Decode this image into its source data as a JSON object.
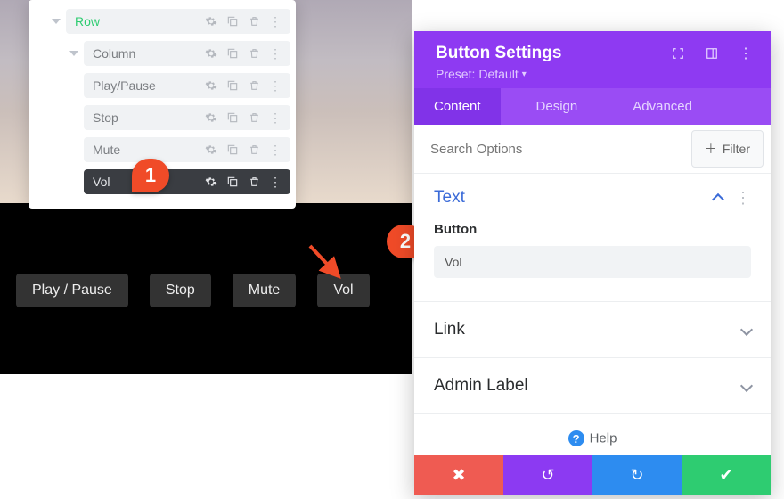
{
  "structure": {
    "row": "Row",
    "column": "Column",
    "items": [
      "Play/Pause",
      "Stop",
      "Mute",
      "Vol"
    ]
  },
  "live_buttons": [
    "Play / Pause",
    "Stop",
    "Mute",
    "Vol"
  ],
  "markers": {
    "one": "1",
    "two": "2"
  },
  "settings": {
    "title": "Button Settings",
    "preset_prefix": "Preset:",
    "preset_value": "Default",
    "tabs": {
      "content": "Content",
      "design": "Design",
      "advanced": "Advanced"
    },
    "search_placeholder": "Search Options",
    "filter_label": "Filter",
    "sections": {
      "text": {
        "title": "Text",
        "field_label": "Button",
        "field_value": "Vol"
      },
      "link": {
        "title": "Link"
      },
      "admin": {
        "title": "Admin Label"
      }
    },
    "help": "Help"
  },
  "colors": {
    "purple": "#8e3af2",
    "red": "#ef5b52",
    "blue": "#2d8cf0",
    "green": "#2ecc71",
    "marker": "#f04b28"
  }
}
